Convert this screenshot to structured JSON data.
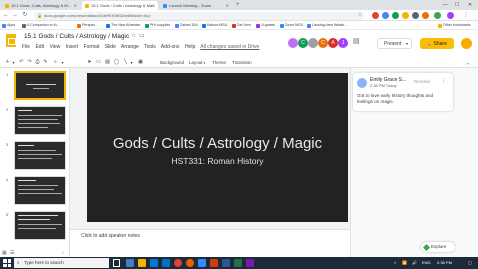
{
  "browser": {
    "tabs": [
      {
        "title": "15.1 Gods, Cults, Astrology & M...",
        "active": false,
        "color": "#f4b400"
      },
      {
        "title": "15.1 Gods / Cults / Astrology & Ma...",
        "active": true,
        "color": "#f4b400"
      },
      {
        "title": "Launch Meeting - Zoom",
        "active": false,
        "color": "#2d8cff"
      }
    ],
    "url": "docs.google.com/presentation/d/1bRKK5K6lI/edit#slide=id.p",
    "bookmarks": [
      {
        "label": "Apps",
        "color": "#4285f4"
      },
      {
        "label": "A Companion to th...",
        "color": "#5f6368"
      },
      {
        "label": "Perspec...",
        "color": "#e8710a"
      },
      {
        "label": "The New Athenian",
        "color": "#1a73e8"
      },
      {
        "label": "PHI supplies",
        "color": "#0f9d58"
      },
      {
        "label": "Zahavi DAI",
        "color": "#4285f4"
      },
      {
        "label": "Kaltura MSU",
        "color": "#1a73e8"
      },
      {
        "label": "Dal Vern",
        "color": "#d93025"
      },
      {
        "label": "Ji gcasts",
        "color": "#9334e6"
      },
      {
        "label": "Zoom MSU",
        "color": "#2d8cff"
      },
      {
        "label": "Lansing Area Weath...",
        "color": "#4285f4"
      },
      {
        "label": "Other bookmarks",
        "color": "#f4b400"
      }
    ]
  },
  "docs": {
    "title": "15.1 Gods / Cults / Astrology / Magic",
    "menu": [
      "File",
      "Edit",
      "View",
      "Insert",
      "Format",
      "Slide",
      "Arrange",
      "Tools",
      "Add-ons",
      "Help"
    ],
    "saved_status": "All changes saved in Drive",
    "present_label": "Present",
    "share_label": "Share",
    "collaborators": [
      {
        "initial": "",
        "color": "#c26ef5"
      },
      {
        "initial": "C",
        "color": "#0f9d58"
      },
      {
        "initial": "",
        "color": "#9aa0a6"
      },
      {
        "initial": "C",
        "color": "#e8710a"
      },
      {
        "initial": "A",
        "color": "#d93025"
      },
      {
        "initial": "J",
        "color": "#a142f4"
      }
    ]
  },
  "toolbar": {
    "background": "Background",
    "layout": "Layout",
    "theme": "Theme",
    "transition": "Transition"
  },
  "filmstrip": {
    "slides": [
      {
        "num": "1",
        "selected": true
      },
      {
        "num": "2",
        "selected": false
      },
      {
        "num": "3",
        "selected": false
      },
      {
        "num": "4",
        "selected": false
      },
      {
        "num": "5",
        "selected": false
      }
    ]
  },
  "slide": {
    "title": "Gods / Cults / Astrology / Magic",
    "subtitle": "HST331: Roman History"
  },
  "notes": {
    "placeholder": "Click to add speaker notes"
  },
  "comment": {
    "author": "Emily Grace S...",
    "time": "2:38 PM Today",
    "resolve": "Resolve",
    "body": "Got to love early history thoughts and feelings on magic."
  },
  "explore": {
    "label": "Explore"
  },
  "taskbar": {
    "search_placeholder": "Type here to search",
    "lang": "ENG",
    "time": "2:38 PM"
  }
}
